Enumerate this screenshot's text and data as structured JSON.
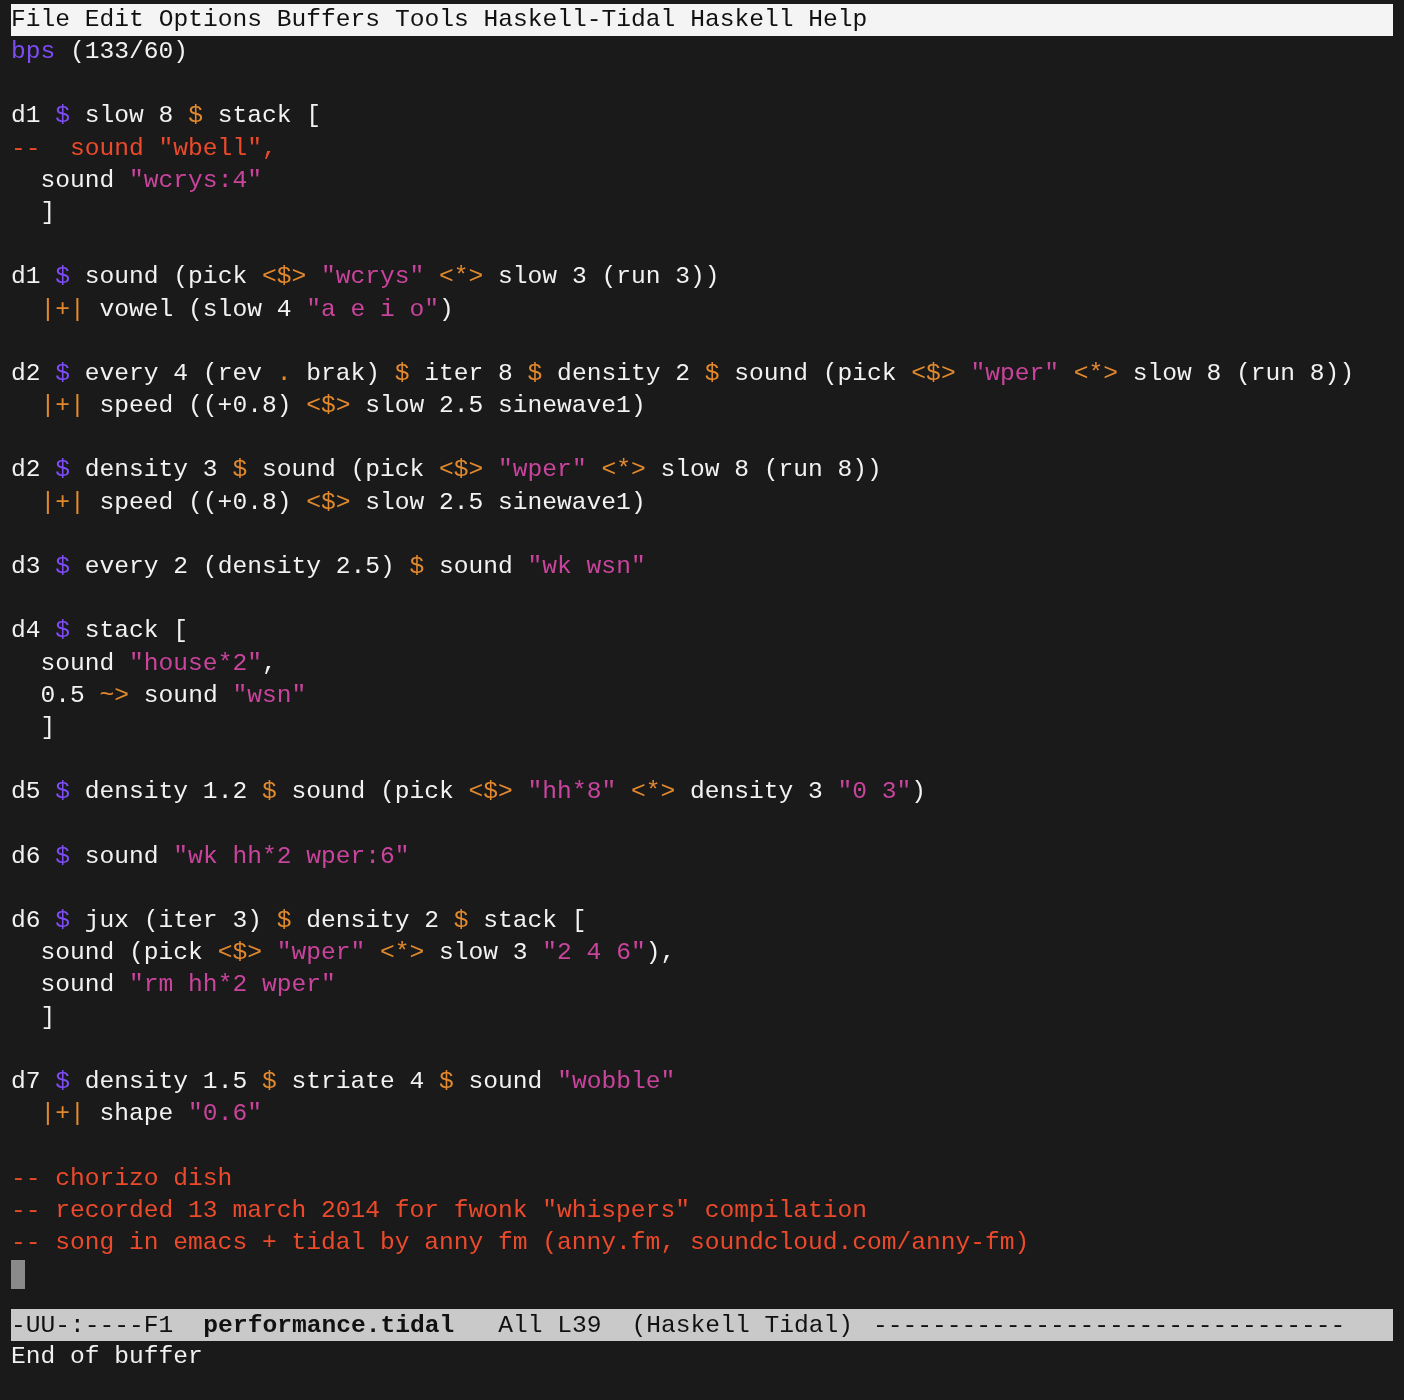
{
  "menu_bar": [
    "File",
    "Edit",
    "Options",
    "Buffers",
    "Tools",
    "Haskell-Tidal",
    "Haskell",
    "Help"
  ],
  "buffer": {
    "blocks": [
      {
        "lines": [
          [
            {
              "kind": "var",
              "text": "bps"
            },
            {
              "kind": "plain",
              "text": " (133/60)"
            }
          ]
        ]
      },
      {
        "lines": [
          [
            {
              "kind": "plain",
              "text": "d1 "
            },
            {
              "kind": "var",
              "text": "$"
            },
            {
              "kind": "plain",
              "text": " slow 8 "
            },
            {
              "kind": "op",
              "text": "$"
            },
            {
              "kind": "plain",
              "text": " stack ["
            }
          ],
          [
            {
              "kind": "comment",
              "text": "--  sound \"wbell\","
            }
          ],
          [
            {
              "kind": "plain",
              "text": "  sound "
            },
            {
              "kind": "str",
              "text": "\"wcrys:4\""
            }
          ],
          [
            {
              "kind": "plain",
              "text": "  ]"
            }
          ]
        ]
      },
      {
        "lines": [
          [
            {
              "kind": "plain",
              "text": "d1 "
            },
            {
              "kind": "var",
              "text": "$"
            },
            {
              "kind": "plain",
              "text": " sound (pick "
            },
            {
              "kind": "op",
              "text": "<$>"
            },
            {
              "kind": "str",
              "text": " \"wcrys\""
            },
            {
              "kind": "op",
              "text": " <*>"
            },
            {
              "kind": "plain",
              "text": " slow 3 (run 3))"
            }
          ],
          [
            {
              "kind": "op",
              "text": "  |+|"
            },
            {
              "kind": "plain",
              "text": " vowel (slow 4 "
            },
            {
              "kind": "str",
              "text": "\"a e i o\""
            },
            {
              "kind": "plain",
              "text": ")"
            }
          ]
        ]
      },
      {
        "lines": [
          [
            {
              "kind": "plain",
              "text": "d2 "
            },
            {
              "kind": "var",
              "text": "$"
            },
            {
              "kind": "plain",
              "text": " every 4 (rev "
            },
            {
              "kind": "op",
              "text": "."
            },
            {
              "kind": "plain",
              "text": " brak) "
            },
            {
              "kind": "op",
              "text": "$"
            },
            {
              "kind": "plain",
              "text": " iter 8 "
            },
            {
              "kind": "op",
              "text": "$"
            },
            {
              "kind": "plain",
              "text": " density 2 "
            },
            {
              "kind": "op",
              "text": "$"
            },
            {
              "kind": "plain",
              "text": " sound (pick "
            },
            {
              "kind": "op",
              "text": "<$>"
            },
            {
              "kind": "str",
              "text": " \"wper\""
            },
            {
              "kind": "op",
              "text": " <*>"
            },
            {
              "kind": "plain",
              "text": " slow 8 (run 8))"
            }
          ],
          [
            {
              "kind": "op",
              "text": "  |+|"
            },
            {
              "kind": "plain",
              "text": " speed ((+0.8) "
            },
            {
              "kind": "op",
              "text": "<$>"
            },
            {
              "kind": "plain",
              "text": " slow 2.5 sinewave1)"
            }
          ]
        ]
      },
      {
        "lines": [
          [
            {
              "kind": "plain",
              "text": "d2 "
            },
            {
              "kind": "var",
              "text": "$"
            },
            {
              "kind": "plain",
              "text": " density 3 "
            },
            {
              "kind": "op",
              "text": "$"
            },
            {
              "kind": "plain",
              "text": " sound (pick "
            },
            {
              "kind": "op",
              "text": "<$>"
            },
            {
              "kind": "str",
              "text": " \"wper\""
            },
            {
              "kind": "op",
              "text": " <*>"
            },
            {
              "kind": "plain",
              "text": " slow 8 (run 8))"
            }
          ],
          [
            {
              "kind": "op",
              "text": "  |+|"
            },
            {
              "kind": "plain",
              "text": " speed ((+0.8) "
            },
            {
              "kind": "op",
              "text": "<$>"
            },
            {
              "kind": "plain",
              "text": " slow 2.5 sinewave1)"
            }
          ]
        ]
      },
      {
        "lines": [
          [
            {
              "kind": "plain",
              "text": "d3 "
            },
            {
              "kind": "var",
              "text": "$"
            },
            {
              "kind": "plain",
              "text": " every 2 (density 2.5) "
            },
            {
              "kind": "op",
              "text": "$"
            },
            {
              "kind": "plain",
              "text": " sound "
            },
            {
              "kind": "str",
              "text": "\"wk wsn\""
            }
          ]
        ]
      },
      {
        "lines": [
          [
            {
              "kind": "plain",
              "text": "d4 "
            },
            {
              "kind": "var",
              "text": "$"
            },
            {
              "kind": "plain",
              "text": " stack ["
            }
          ],
          [
            {
              "kind": "plain",
              "text": "  sound "
            },
            {
              "kind": "str",
              "text": "\"house*2\""
            },
            {
              "kind": "plain",
              "text": ","
            }
          ],
          [
            {
              "kind": "plain",
              "text": "  0.5 "
            },
            {
              "kind": "op",
              "text": "~>"
            },
            {
              "kind": "plain",
              "text": " sound "
            },
            {
              "kind": "str",
              "text": "\"wsn\""
            }
          ],
          [
            {
              "kind": "plain",
              "text": "  ]"
            }
          ]
        ]
      },
      {
        "lines": [
          [
            {
              "kind": "plain",
              "text": "d5 "
            },
            {
              "kind": "var",
              "text": "$"
            },
            {
              "kind": "plain",
              "text": " density 1.2 "
            },
            {
              "kind": "op",
              "text": "$"
            },
            {
              "kind": "plain",
              "text": " sound (pick "
            },
            {
              "kind": "op",
              "text": "<$>"
            },
            {
              "kind": "str",
              "text": " \"hh*8\""
            },
            {
              "kind": "op",
              "text": " <*>"
            },
            {
              "kind": "plain",
              "text": " density 3 "
            },
            {
              "kind": "str",
              "text": "\"0 3\""
            },
            {
              "kind": "plain",
              "text": ")"
            }
          ]
        ]
      },
      {
        "lines": [
          [
            {
              "kind": "plain",
              "text": "d6 "
            },
            {
              "kind": "var",
              "text": "$"
            },
            {
              "kind": "plain",
              "text": " sound "
            },
            {
              "kind": "str",
              "text": "\"wk hh*2 wper:6\""
            }
          ]
        ]
      },
      {
        "lines": [
          [
            {
              "kind": "plain",
              "text": "d6 "
            },
            {
              "kind": "var",
              "text": "$"
            },
            {
              "kind": "plain",
              "text": " jux (iter 3) "
            },
            {
              "kind": "op",
              "text": "$"
            },
            {
              "kind": "plain",
              "text": " density 2 "
            },
            {
              "kind": "op",
              "text": "$"
            },
            {
              "kind": "plain",
              "text": " stack ["
            }
          ],
          [
            {
              "kind": "plain",
              "text": "  sound (pick "
            },
            {
              "kind": "op",
              "text": "<$>"
            },
            {
              "kind": "str",
              "text": " \"wper\""
            },
            {
              "kind": "op",
              "text": " <*>"
            },
            {
              "kind": "plain",
              "text": " slow 3 "
            },
            {
              "kind": "str",
              "text": "\"2 4 6\""
            },
            {
              "kind": "plain",
              "text": "),"
            }
          ],
          [
            {
              "kind": "plain",
              "text": "  sound "
            },
            {
              "kind": "str",
              "text": "\"rm hh*2 wper\""
            }
          ],
          [
            {
              "kind": "plain",
              "text": "  ]"
            }
          ]
        ]
      },
      {
        "lines": [
          [
            {
              "kind": "plain",
              "text": "d7 "
            },
            {
              "kind": "var",
              "text": "$"
            },
            {
              "kind": "plain",
              "text": " density 1.5 "
            },
            {
              "kind": "op",
              "text": "$"
            },
            {
              "kind": "plain",
              "text": " striate 4 "
            },
            {
              "kind": "op",
              "text": "$"
            },
            {
              "kind": "plain",
              "text": " sound "
            },
            {
              "kind": "str",
              "text": "\"wobble\""
            }
          ],
          [
            {
              "kind": "op",
              "text": "  |+|"
            },
            {
              "kind": "plain",
              "text": " shape "
            },
            {
              "kind": "str",
              "text": "\"0.6\""
            }
          ]
        ]
      },
      {
        "lines": [
          [
            {
              "kind": "comment",
              "text": "-- chorizo dish"
            }
          ],
          [
            {
              "kind": "comment",
              "text": "-- recorded 13 march 2014 for fwonk \"whispers\" compilation"
            }
          ],
          [
            {
              "kind": "comment",
              "text": "-- song in emacs + tidal by anny fm (anny.fm, soundcloud.com/anny-fm)"
            }
          ]
        ]
      }
    ]
  },
  "mode_line": {
    "status": "-UU-:----F1",
    "buffer_name": "performance.tidal",
    "position": "All L39",
    "mode": "(Haskell Tidal)",
    "fill": "--------------------------------"
  },
  "echo_area": "End of buffer"
}
